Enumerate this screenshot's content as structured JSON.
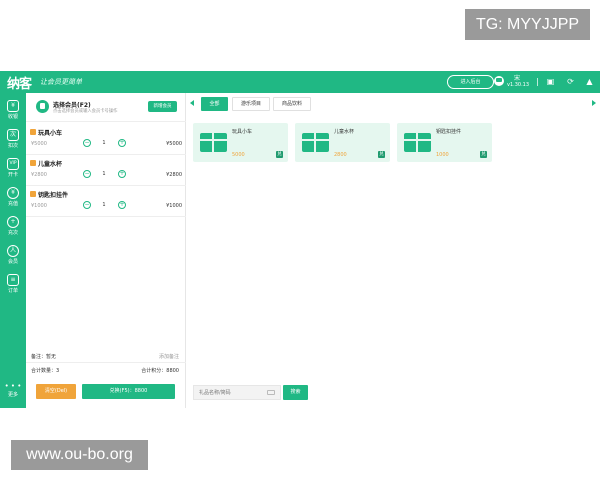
{
  "watermarks": {
    "top": "TG: MYYJJPP",
    "bottom": "www.ou-bo.org"
  },
  "header": {
    "logo": "纳客",
    "slogan": "让会员更简单",
    "enter_bg_button": "进入后台",
    "user": "宋",
    "version": "v1.30.13",
    "icons": [
      "printer-icon",
      "refresh-icon",
      "bell-icon"
    ]
  },
  "sidebar": {
    "items": [
      {
        "label": "收银",
        "icon": "cashier-icon",
        "glyph": "¥"
      },
      {
        "label": "扣次",
        "icon": "deduct-count-icon",
        "glyph": "次"
      },
      {
        "label": "开卡",
        "icon": "vip-card-icon",
        "glyph": "VIP"
      },
      {
        "label": "充值",
        "icon": "recharge-icon",
        "glyph": "¥"
      },
      {
        "label": "充次",
        "icon": "recharge-count-icon",
        "glyph": "+"
      },
      {
        "label": "会员",
        "icon": "member-icon",
        "glyph": "人"
      },
      {
        "label": "订单",
        "icon": "order-icon",
        "glyph": "≡"
      }
    ],
    "more_label": "更多",
    "more_glyph": "• • •"
  },
  "cart": {
    "member_title": "选择会员(F2)",
    "member_sub": "点击选择会员或输入会员卡号操作",
    "add_member": "新增会员",
    "items": [
      {
        "name": "玩具小车",
        "price": "¥5000",
        "qty": "1",
        "total": "¥5000"
      },
      {
        "name": "儿童水杯",
        "price": "¥2800",
        "qty": "1",
        "total": "¥2800"
      },
      {
        "name": "钥匙扣挂件",
        "price": "¥1000",
        "qty": "1",
        "total": "¥1000"
      }
    ],
    "minus": "−",
    "plus": "+",
    "remark_label": "备注：暂无",
    "remark_add": "添加备注",
    "sum_count": "合计数量：3",
    "sum_points": "合计积分：8800",
    "clear_button": "清空(Del)",
    "redeem_button": "兑换(F5)：8800"
  },
  "main": {
    "tabs": [
      "全部",
      "游乐项目",
      "商品饮料"
    ],
    "products": [
      {
        "name": "玩具小车",
        "price": "5000",
        "badge": "兑"
      },
      {
        "name": "儿童水杯",
        "price": "2800",
        "badge": "兑"
      },
      {
        "name": "钥匙扣挂件",
        "price": "1000",
        "badge": "兑"
      }
    ],
    "search_placeholder": "礼品名称/简码",
    "search_button": "搜索"
  },
  "colors": {
    "brand": "#20b884",
    "accent": "#f0a43a",
    "bg": "#f6f7f8"
  }
}
